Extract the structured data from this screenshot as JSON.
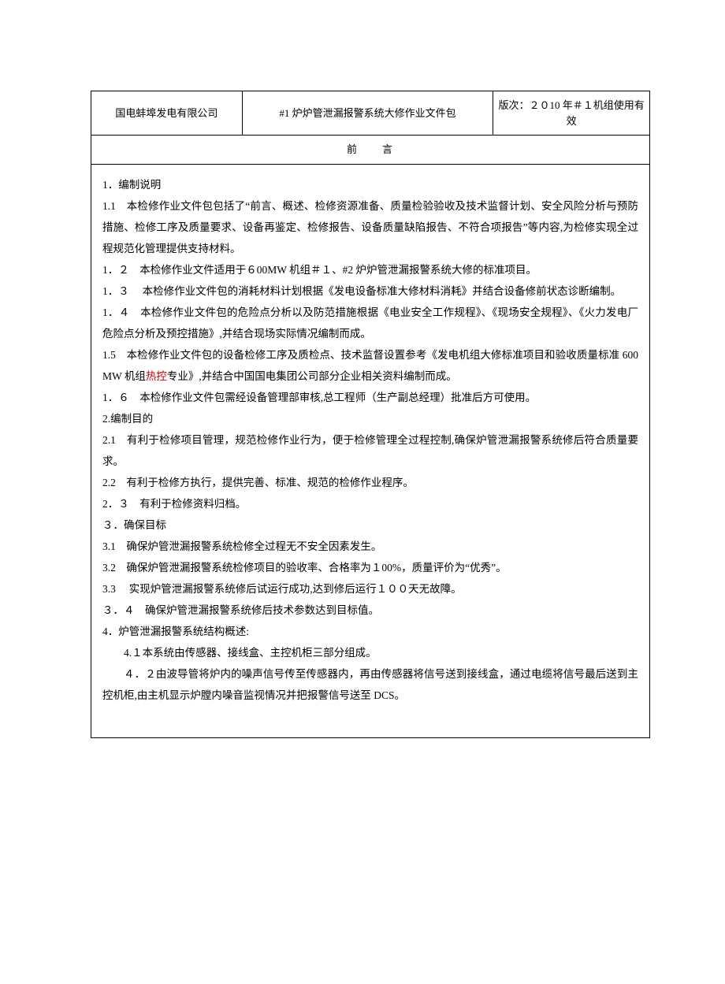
{
  "header": {
    "company": "国电蚌埠发电有限公司",
    "doc_title": "#1 炉炉管泄漏报警系统大修作业文件包",
    "version": "版次：２０10 年＃１机组使用有效"
  },
  "preface_title": "前　　言",
  "body": {
    "s1_heading": "1．编制说明",
    "s1_1": "1.1　本检修作业文件包包括了“前言、概述、检修资源准备、质量检验验收及技术监督计划、安全风险分析与预防措施、检修工序及质量要求、设备再鉴定、检修报告、设备质量缺陷报告、不符合项报告”等内容,为检修实现全过程规范化管理提供支持材料。",
    "s1_2": "1．２　本检修作业文件适用于６00MW 机组＃１、#2 炉炉管泄漏报警系统大修的标准项目。",
    "s1_3": "1．３　 本检修作业文件包的消耗材料计划根据《发电设备标准大修材料消耗》并结合设备修前状态诊断编制。",
    "s1_4": "1．４　本检修作业文件包的危险点分析以及防范措施根据《电业安全工作规程》、《现场安全规程》、《火力发电厂危险点分析及预控措施》,并结合现场实际情况编制而成。",
    "s1_5_pre": "1.5　本检修作业文件包的设备检修工序及质检点、技术监督设置参考《发电机组大修标准项目和验收质量标准 600 MW 机组",
    "s1_5_red": "热控",
    "s1_5_post": "专业》,并结合中国国电集团公司部分企业相关资料编制而成。",
    "s1_6": "1．６　本检修作业文件包需经设备管理部审核,总工程师（生产副总经理）批准后方可使用。",
    "s2_heading": "2.编制目的",
    "s2_1": "2.1　有利于检修项目管理，规范检修作业行为，便于检修管理全过程控制,确保炉管泄漏报警系统修后符合质量要求。",
    "s2_2": "2.2　有利于检修方执行，提供完善、标准、规范的检修作业程序。",
    "s2_3": "2．３　有利于检修资料归档。",
    "s3_heading": "３．确保目标",
    "s3_1": "3.1　确保炉管泄漏报警系统检修全过程无不安全因素发生。",
    "s3_2": "3.2　确保炉管泄漏报警系统检修项目的验收率、合格率为１00%，质量评价为“优秀”。",
    "s3_3": "3.3　  实现炉管泄漏报警系统修后试运行成功,达到修后运行１００天无故障。",
    "s3_4": "３．４　确保炉管泄漏报警系统修后技术参数达到目标值。",
    "s4_heading": "4．炉管泄漏报警系统结构概述:",
    "s4_1": "4.１本系统由传感器、接线盒、主控机柜三部分组成。",
    "s4_2": "４．２由波导管将炉内的噪声信号传至传感器内，再由传感器将信号送到接线盒，通过电缆将信号最后送到主控机柜,由主机显示炉膛内噪音监视情况并把报警信号送至 DCS。"
  }
}
